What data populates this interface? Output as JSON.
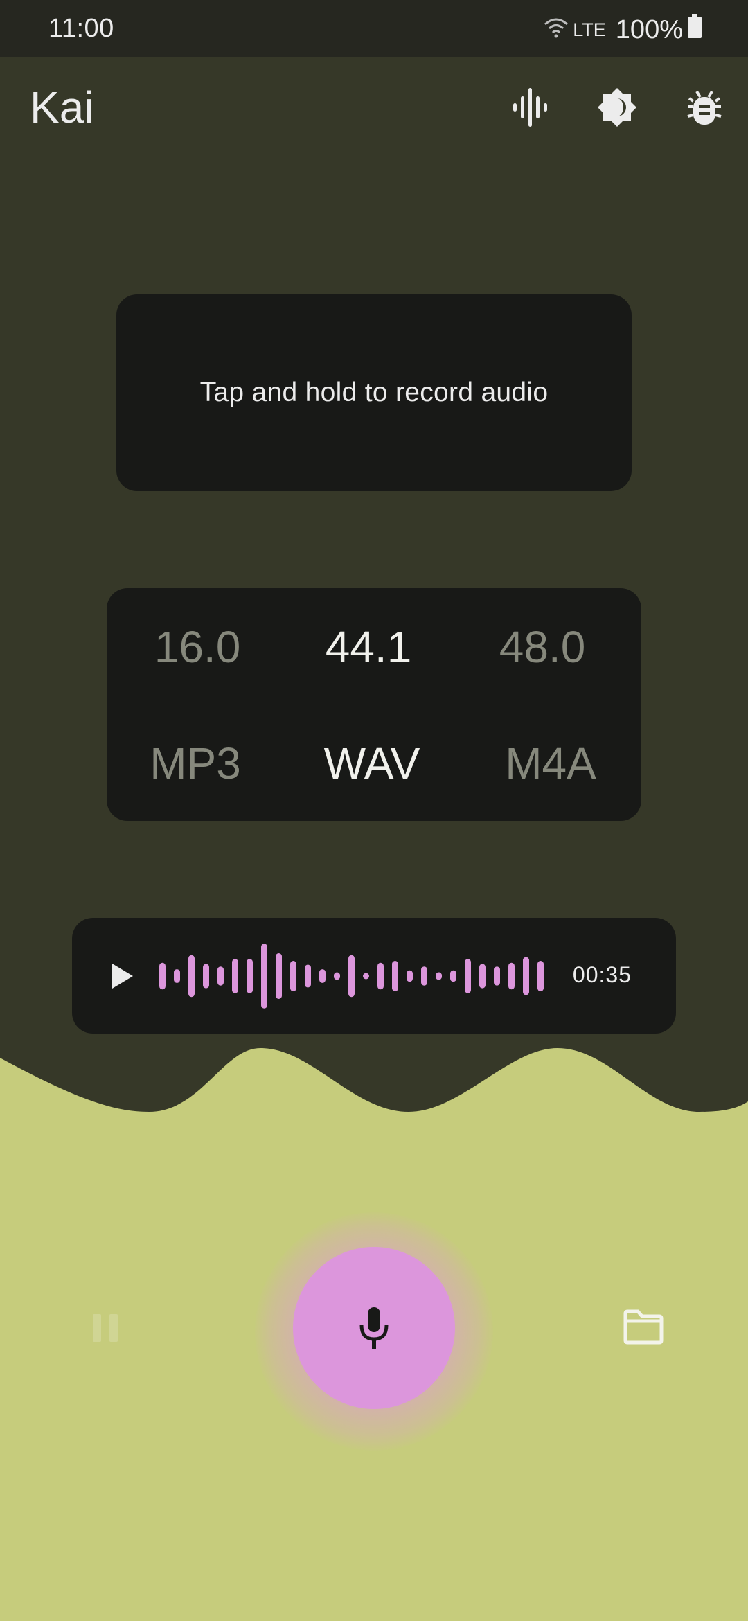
{
  "status_bar": {
    "time": "11:00",
    "network": "LTE",
    "battery": "100%",
    "icons": [
      "wifi-icon",
      "battery-icon"
    ]
  },
  "app_bar": {
    "title": "Kai",
    "actions": [
      "waveform-icon",
      "brightness-icon",
      "bug-icon"
    ]
  },
  "record_hint": "Tap and hold to record audio",
  "sample_rates": {
    "options": [
      "16.0",
      "44.1",
      "48.0"
    ],
    "selected": "44.1"
  },
  "formats": {
    "options": [
      "MP3",
      "WAV",
      "M4A"
    ],
    "selected": "WAV"
  },
  "recording": {
    "duration": "00:35",
    "waveform_levels": [
      0.35,
      0.18,
      0.55,
      0.32,
      0.25,
      0.45,
      0.45,
      0.85,
      0.6,
      0.4,
      0.3,
      0.18,
      0.1,
      0.55,
      0.05,
      0.35,
      0.4,
      0.15,
      0.25,
      0.1,
      0.15,
      0.45,
      0.32,
      0.25,
      0.35,
      0.5,
      0.4
    ]
  },
  "controls": {
    "pause_icon": "pause-icon",
    "mic_icon": "microphone-icon",
    "folder_icon": "folder-icon"
  },
  "colors": {
    "background_dark": "#363828",
    "card": "#181917",
    "background_light": "#c6cc7c",
    "accent": "#dc96dc",
    "text": "#ececec",
    "muted_text": "#86887c"
  }
}
